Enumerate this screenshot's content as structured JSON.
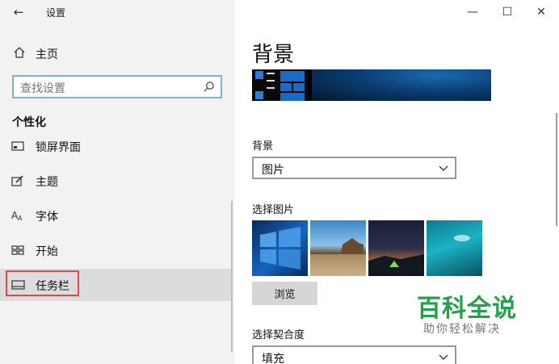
{
  "window": {
    "title": "设置",
    "back_icon": "back-arrow-icon",
    "controls": {
      "minimize": "—",
      "maximize": "☐",
      "close": "✕"
    }
  },
  "sidebar": {
    "home_label": "主页",
    "search_placeholder": "查找设置",
    "section_title": "个性化",
    "items": [
      {
        "label": "锁屏界面",
        "icon": "lock-screen-icon"
      },
      {
        "label": "主题",
        "icon": "theme-brush-icon"
      },
      {
        "label": "字体",
        "icon": "font-icon"
      },
      {
        "label": "开始",
        "icon": "start-grid-icon"
      },
      {
        "label": "任务栏",
        "icon": "taskbar-icon",
        "selected": true
      }
    ]
  },
  "main": {
    "title": "背景",
    "background_label": "背景",
    "background_value": "图片",
    "choose_picture_label": "选择图片",
    "browse_label": "浏览",
    "fit_label": "选择契合度",
    "fit_value": "填充"
  },
  "watermark": {
    "main": "百科全说",
    "sub": "助你轻松解决"
  },
  "colors": {
    "accent": "#0078d7",
    "highlight_box": "#e0484a",
    "watermark": "#22a04a"
  }
}
